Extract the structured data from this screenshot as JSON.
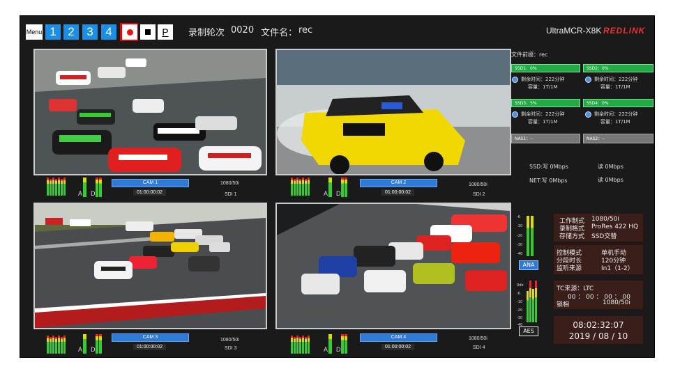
{
  "topbar": {
    "menu_label": "Menu",
    "view_buttons": [
      "1",
      "2",
      "3",
      "4"
    ],
    "play_label": "P",
    "record_round_label": "录制轮次",
    "record_round_value": "0020",
    "filename_label": "文件名：",
    "filename_value": "rec",
    "model": "UltraMCR-X8K",
    "brand": "REDLINK"
  },
  "cameras": [
    {
      "label": "CAM 1",
      "timecode": "01:00:00:02",
      "format": "1080/50i",
      "source": "SDI 1"
    },
    {
      "label": "CAM 2",
      "timecode": "01:00:00:02",
      "format": "1080/50i",
      "source": "SDI 2"
    },
    {
      "label": "CAM 3",
      "timecode": "01:00:00:02",
      "format": "1080/50i",
      "source": "SDI 3"
    },
    {
      "label": "CAM 4",
      "timecode": "01:00:00:02",
      "format": "1080/50i",
      "source": "SDI 4"
    }
  ],
  "meter_labels": {
    "a": "A",
    "d": "D",
    "unit": "dB"
  },
  "storage": {
    "prefix": "文件前缀：rec",
    "ssd1": "SSD1：0%",
    "ssd2": "SSD2：0%",
    "ssd3": "SSD3：5%",
    "ssd4": "SSD4：0%",
    "remaining": "剩余时间：222分钟",
    "capacity": "容量：1T/1M",
    "nas1": "NAS1：--",
    "nas2": "NAS2：--",
    "ssd_write": "SSD:写 0Mbps",
    "ssd_read": "读 0Mbps",
    "net_write": "NET:写 0Mbps",
    "net_read": "读 0Mbps"
  },
  "audio": {
    "ana_label": "ANA",
    "aes_label": "AES",
    "scale": [
      "-6",
      "-10",
      "-20",
      "-30",
      "-40"
    ],
    "aes_scale": [
      "0db",
      "-6",
      "-10",
      "-20",
      "-30",
      "-40"
    ]
  },
  "work": {
    "mode_label": "工作制式",
    "mode_value": "1080/50i",
    "format_label": "录制格式",
    "format_value": "ProRes 422 HQ",
    "storage_label": "存储方式",
    "storage_value": "SSD交替"
  },
  "control": {
    "ctrl_label": "控制模式",
    "ctrl_value": "单机手动",
    "seg_label": "分段时长",
    "seg_value": "120分钟",
    "mon_label": "监听来源",
    "mon_value": "In1（1-2）"
  },
  "tc": {
    "source": "TC来源：LTC",
    "value": "00 ： 00 ： 00 ： 00",
    "lock_label": "锁相",
    "lock_value": "1080/50i"
  },
  "clock": {
    "time": "08:02:32:07",
    "date": "2019 / 08 / 10"
  },
  "colors": {
    "accent": "#1a8fe8",
    "ssd_green": "#22aa44",
    "record_red": "#ee1111",
    "info_bg": "#3a1e1a"
  }
}
